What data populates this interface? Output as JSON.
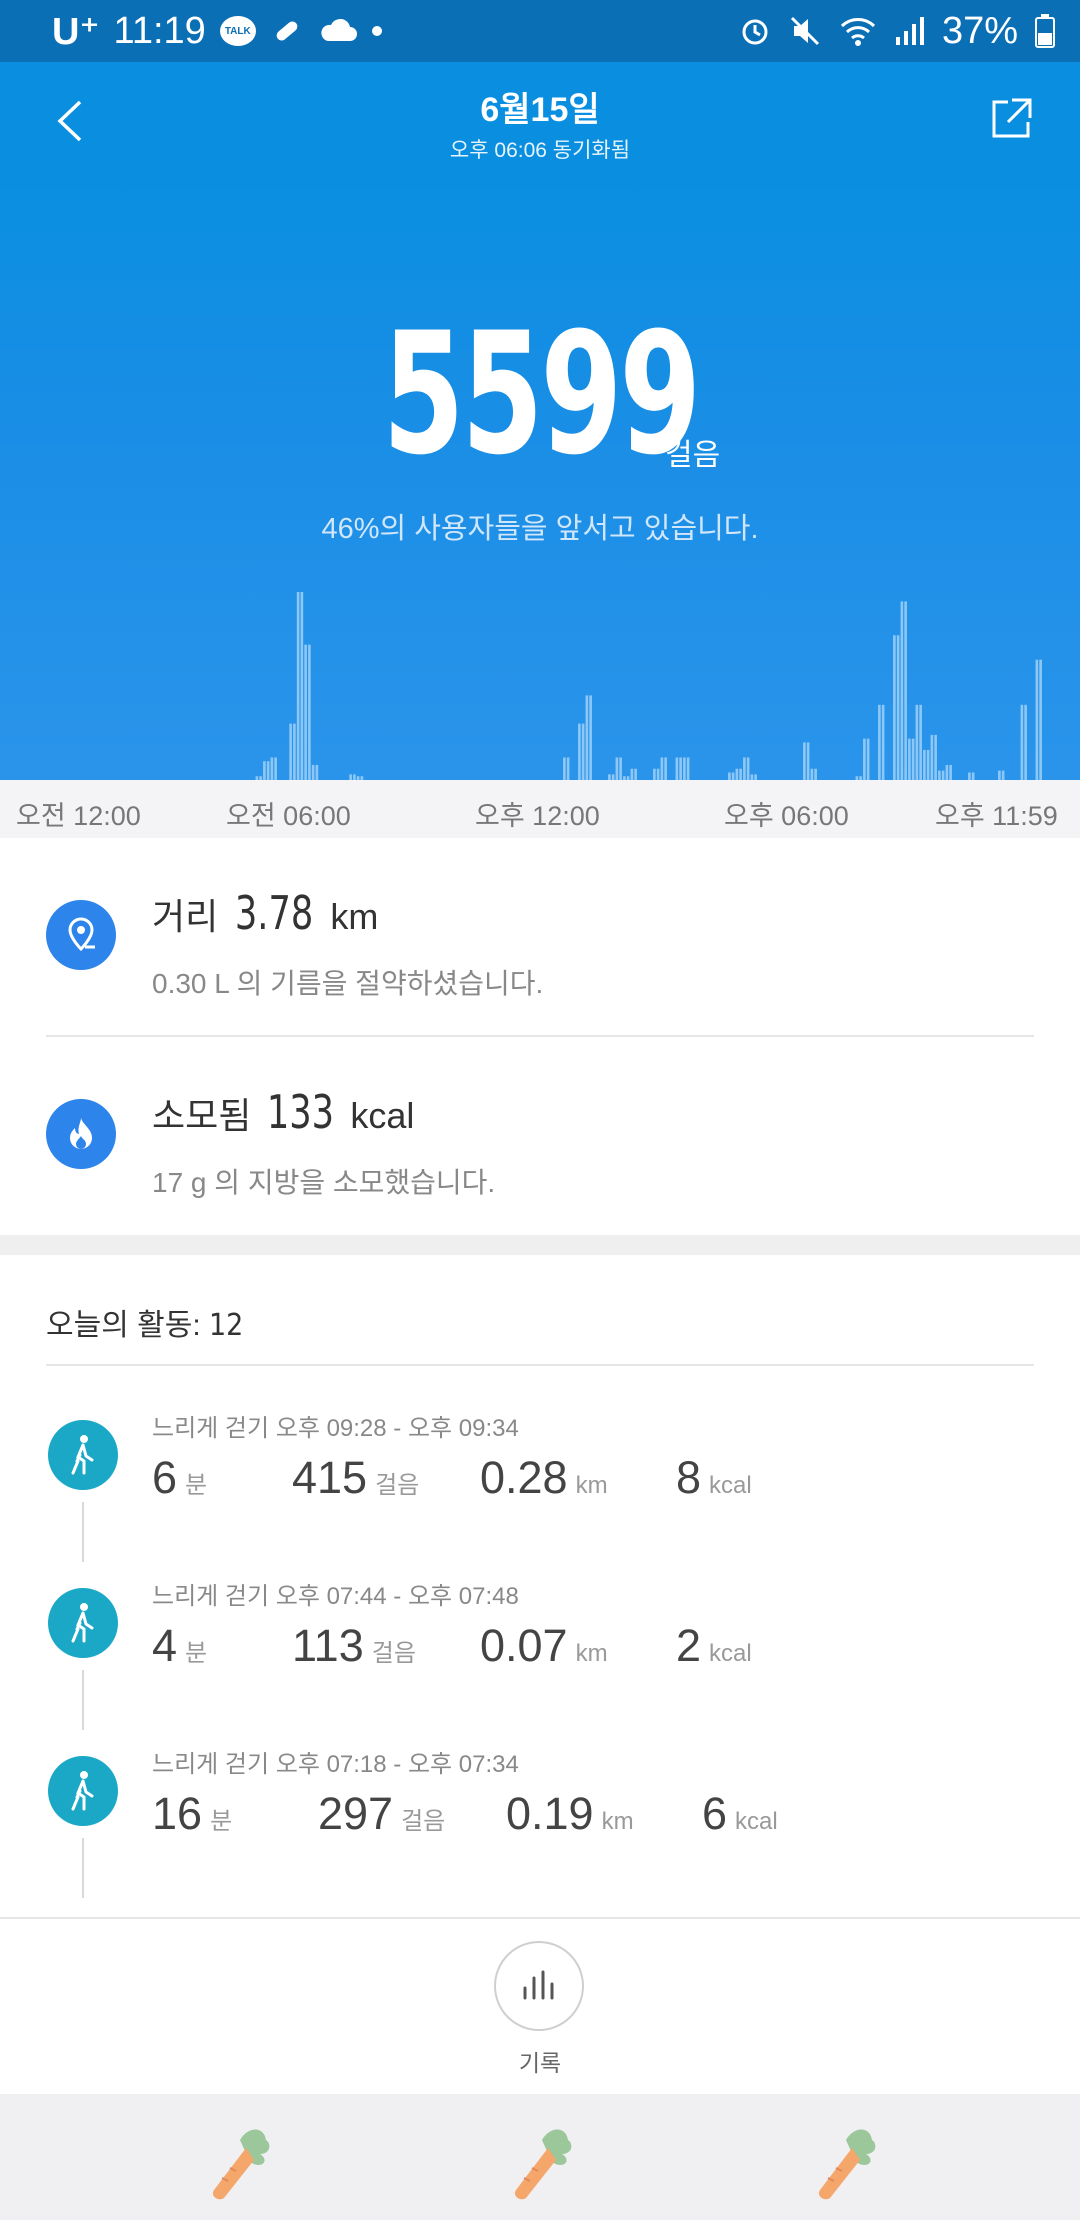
{
  "status_bar": {
    "carrier": "U⁺",
    "time": "11:19",
    "battery": "37%"
  },
  "header": {
    "title": "6월15일",
    "subtitle": "오후 06:06 동기화됨"
  },
  "summary": {
    "steps": "5599",
    "steps_unit": "걸음",
    "rank_text": "46%의 사용자들을 앞서고 있습니다."
  },
  "chart_data": {
    "type": "bar",
    "ylim": [
      0,
      100
    ],
    "values": [
      0,
      0,
      0,
      0,
      0,
      0,
      0,
      0,
      0,
      0,
      0,
      0,
      0,
      0,
      0,
      0,
      0,
      0,
      0,
      0,
      0,
      0,
      0,
      0,
      0,
      0,
      0,
      0,
      0,
      0,
      0,
      0,
      0,
      0,
      0,
      0,
      0,
      0,
      0,
      0,
      0,
      0,
      0,
      0,
      0,
      0,
      0,
      0,
      0,
      0,
      0,
      0,
      0,
      0,
      0,
      0,
      0,
      0,
      0,
      0,
      0,
      0,
      0,
      0,
      0,
      0,
      0,
      0,
      2,
      2,
      10,
      10,
      12,
      12,
      0,
      0,
      0,
      30,
      30,
      100,
      100,
      72,
      72,
      8,
      8,
      0,
      0,
      0,
      0,
      0,
      0,
      0,
      0,
      3,
      3,
      2,
      2,
      0,
      0,
      0,
      0,
      0,
      0,
      0,
      0,
      0,
      0,
      0,
      0,
      0,
      0,
      0,
      0,
      0,
      0,
      0,
      0,
      0,
      0,
      0,
      0,
      0,
      0,
      0,
      0,
      0,
      0,
      0,
      0,
      0,
      0,
      0,
      0,
      0,
      0,
      0,
      0,
      0,
      0,
      0,
      0,
      0,
      0,
      0,
      0,
      0,
      0,
      0,
      0,
      0,
      12,
      12,
      0,
      0,
      30,
      30,
      45,
      45,
      0,
      0,
      0,
      0,
      3,
      3,
      12,
      12,
      2,
      2,
      6,
      6,
      0,
      0,
      0,
      0,
      6,
      6,
      12,
      12,
      0,
      0,
      12,
      12,
      12,
      12,
      0,
      0,
      0,
      0,
      0,
      0,
      0,
      0,
      0,
      0,
      4,
      4,
      6,
      6,
      12,
      12,
      3,
      3,
      0,
      0,
      0,
      0,
      0,
      0,
      0,
      0,
      0,
      0,
      0,
      0,
      20,
      20,
      6,
      6,
      0,
      0,
      0,
      0,
      0,
      0,
      0,
      0,
      0,
      0,
      2,
      2,
      22,
      22,
      0,
      0,
      40,
      40,
      0,
      0,
      77,
      77,
      95,
      95,
      22,
      22,
      40,
      40,
      16,
      16,
      24,
      24,
      5,
      5,
      8,
      8,
      0,
      0,
      0,
      0,
      4,
      4,
      0,
      0,
      0,
      0,
      0,
      0,
      5,
      5,
      0,
      0,
      0,
      0,
      40,
      40,
      0,
      0,
      64,
      64,
      0,
      0,
      0,
      0,
      0,
      0,
      0,
      0,
      0,
      0
    ]
  },
  "time_axis": {
    "labels": [
      "오전 12:00",
      "오전 06:00",
      "오후 12:00",
      "오후 06:00",
      "오후 11:59"
    ]
  },
  "distance": {
    "label": "거리",
    "value": "3.78",
    "unit": "km",
    "sub": "0.30 L 의 기름을 절약하셨습니다."
  },
  "calories": {
    "label": "소모됨",
    "value": "133",
    "unit": "kcal",
    "sub": "17 g 의 지방을 소모했습니다."
  },
  "activities": {
    "title": "오늘의 활동:",
    "count": "12",
    "items": [
      {
        "header": "느리게 걷기 오후 09:28 - 오후 09:34",
        "minutes": "6",
        "min_unit": "분",
        "steps": "415",
        "steps_unit": "걸음",
        "km": "0.28",
        "km_unit": "km",
        "kcal": "8",
        "kcal_unit": "kcal"
      },
      {
        "header": "느리게 걷기 오후 07:44 - 오후 07:48",
        "minutes": "4",
        "min_unit": "분",
        "steps": "113",
        "steps_unit": "걸음",
        "km": "0.07",
        "km_unit": "km",
        "kcal": "2",
        "kcal_unit": "kcal"
      },
      {
        "header": "느리게 걷기 오후 07:18 - 오후 07:34",
        "minutes": "16",
        "min_unit": "분",
        "steps": "297",
        "steps_unit": "걸음",
        "km": "0.19",
        "km_unit": "km",
        "kcal": "6",
        "kcal_unit": "kcal"
      }
    ]
  },
  "bottom": {
    "record_label": "기록"
  },
  "colors": {
    "status_bar": "#0b6fb6",
    "header": "#0a8fe0",
    "stat_icon": "#2d84ea",
    "activity_icon": "#1ba8c6",
    "bar": "#8cc7f5"
  }
}
